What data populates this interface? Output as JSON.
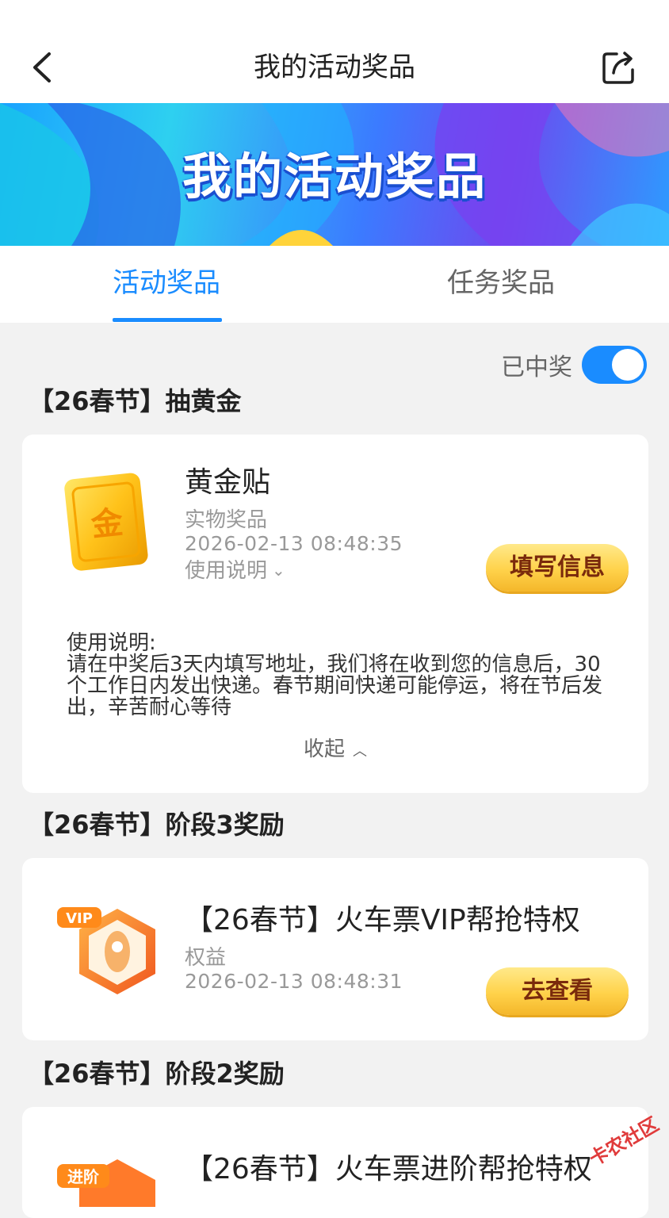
{
  "nav": {
    "title": "我的活动奖品"
  },
  "banner": {
    "title": "我的活动奖品"
  },
  "tabs": [
    {
      "label": "活动奖品",
      "active": true
    },
    {
      "label": "任务奖品",
      "active": false
    }
  ],
  "filter": {
    "label": "已中奖",
    "enabled": true
  },
  "sections": [
    {
      "title": "【26春节】抽黄金",
      "prize": {
        "name": "黄金贴",
        "type": "实物奖品",
        "time": "2026-02-13 08:48:35",
        "usage_toggle": "使用说明",
        "button": "填写信息",
        "usage_text": "使用说明:\n请在中奖后3天内填写地址，我们将在收到您的信息后，30个工作日内发出快递。春节期间快递可能停运，将在节后发出，辛苦耐心等待",
        "collapse": "收起"
      }
    },
    {
      "title": "【26春节】阶段3奖励",
      "prize": {
        "name": "【26春节】火车票VIP帮抢特权",
        "type": "权益",
        "time": "2026-02-13 08:48:31",
        "button": "去查看",
        "badge": "VIP"
      }
    },
    {
      "title": "【26春节】阶段2奖励",
      "prize": {
        "name": "【26春节】火车票进阶帮抢特权",
        "badge": "进阶"
      }
    }
  ],
  "watermark": "卡农社区",
  "icons": {
    "back": "chevron-left-icon",
    "share": "share-icon",
    "gold": "gold-bar-icon",
    "vip": "vip-rocket-icon"
  },
  "colors": {
    "accent": "#1a8cff",
    "button_gold": "#ffd24a",
    "button_text": "#7a2a0c"
  }
}
